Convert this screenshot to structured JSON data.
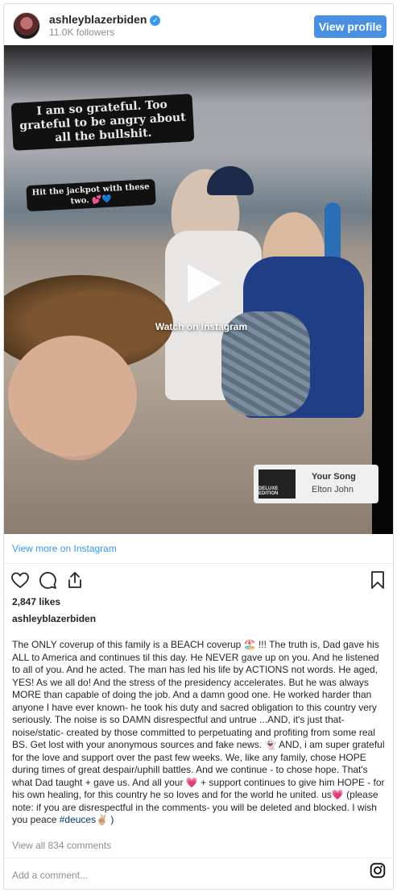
{
  "header": {
    "username": "ashleyblazerbiden",
    "verified_glyph": "✓",
    "followers": "11.0K followers",
    "view_profile_label": "View profile"
  },
  "media": {
    "overlay_caption_1": "I am so grateful. Too grateful to be angry about all the bullshit.",
    "overlay_caption_2": "Hit the jackpot with these two. 💕💙",
    "play_icon": "play-icon",
    "watch_label": "Watch on Instagram",
    "song": {
      "art_label": "DELUXE EDITION",
      "title": "Your Song",
      "artist": "Elton John"
    }
  },
  "view_more_label": "View more on Instagram",
  "actions": {
    "icons": [
      "heart-icon",
      "comment-icon",
      "share-icon",
      "bookmark-icon"
    ]
  },
  "likes": "2,847 likes",
  "owner": "ashleyblazerbiden",
  "caption": {
    "text": "The ONLY coverup of this family is a BEACH coverup 🏖️ !!! The truth is, Dad gave his ALL to America and continues til this day. He NEVER gave up on you. And he listened to all of you. And he acted. The man has led his life by ACTIONS not words. He aged, YES! As we all do! And the stress of the presidency accelerates. But he was always MORE than capable of doing the job. And a damn good one. He worked harder than anyone I have ever known- he took his duty and sacred obligation to this country very seriously. The noise is so DAMN disrespectful and untrue ...AND, it's just that- noise/static- created by those committed to perpetuating and profiting from some real BS. Get lost with your anonymous sources and fake news. 👻 AND, i am super grateful for the love and support over the past few weeks. We, like any family, chose HOPE during times of great despair/uphill battles. And we continue - to chose hope. That's what Dad taught + gave us. And all your 💗 + support continues to give him HOPE - for his own healing, for this country he so loves and for the world he united. us💗 (please note: if you are disrespectful in the comments- you will be deleted and blocked. I wish you peace ",
    "hashtag": "#deuces",
    "suffix": "✌🏼 )"
  },
  "view_all_comments": "View all 834 comments",
  "add_comment_placeholder": "Add a comment...",
  "footer_icon": "instagram-logo-icon",
  "colors": {
    "button_blue": "#4a90e2",
    "link_blue": "#3897f0",
    "muted_gray": "#8e8e8e",
    "text": "#262626"
  }
}
